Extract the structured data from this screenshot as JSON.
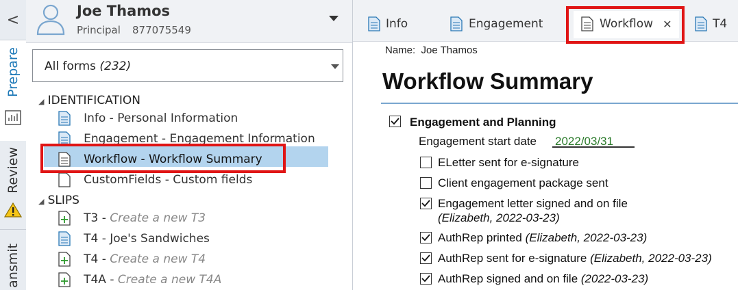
{
  "sidebar": {
    "collapse_glyph": "<",
    "tabs": [
      {
        "label": "Prepare"
      },
      {
        "label": "Review"
      },
      {
        "label": "ansmit"
      }
    ]
  },
  "client": {
    "name": "Joe Thamos",
    "role": "Principal",
    "id": "877075549"
  },
  "forms_filter": {
    "label": "All forms",
    "count": "(232)"
  },
  "tree": {
    "group1": "IDENTIFICATION",
    "info": {
      "code": "Info",
      "desc": " - Personal Information"
    },
    "engagement": {
      "code": "Engagement",
      "desc": " - Engagement Information"
    },
    "workflow": {
      "code": "Workflow",
      "desc": " - Workflow Summary"
    },
    "customfields": {
      "code": "CustomFields",
      "desc": " - Custom fields"
    },
    "group2": "SLIPS",
    "t3new": {
      "code": "T3",
      "sep": " - ",
      "desc": "Create a new T3"
    },
    "t4joe": {
      "code": "T4",
      "desc": " - Joe's Sandwiches"
    },
    "t4new": {
      "code": "T4",
      "sep": " - ",
      "desc": "Create a new T4"
    },
    "t4anew": {
      "code": "T4A",
      "sep": " - ",
      "desc": "Create a new T4A"
    }
  },
  "doc_tabs": {
    "info": "Info",
    "engagement": "Engagement",
    "workflow": "Workflow",
    "t4": "T4",
    "close_glyph": "✕"
  },
  "document": {
    "name_label": "Name:",
    "name_value": "Joe Thamos",
    "title": "Workflow Summary",
    "section": "Engagement and Planning",
    "start_date_label": "Engagement start date",
    "start_date_value": "2022/03/31",
    "items": [
      {
        "text": "ELetter sent for e-signature",
        "note": "",
        "checked": false
      },
      {
        "text": "Client engagement package sent",
        "note": "",
        "checked": false
      },
      {
        "text": "Engagement letter signed and on file",
        "note": "(Elizabeth, 2022-03-23)",
        "checked": true
      },
      {
        "text": "AuthRep printed ",
        "note": "(Elizabeth, 2022-03-23)",
        "checked": true
      },
      {
        "text": "AuthRep sent for e-signature ",
        "note": "(Elizabeth, 2022-03-23)",
        "checked": true
      },
      {
        "text": "AuthRep signed and on file ",
        "note": "(2022-03-23)",
        "checked": true
      }
    ]
  },
  "colors": {
    "accent": "#1f7ab8",
    "selection": "#b3d4ee",
    "highlight": "#e01515"
  }
}
